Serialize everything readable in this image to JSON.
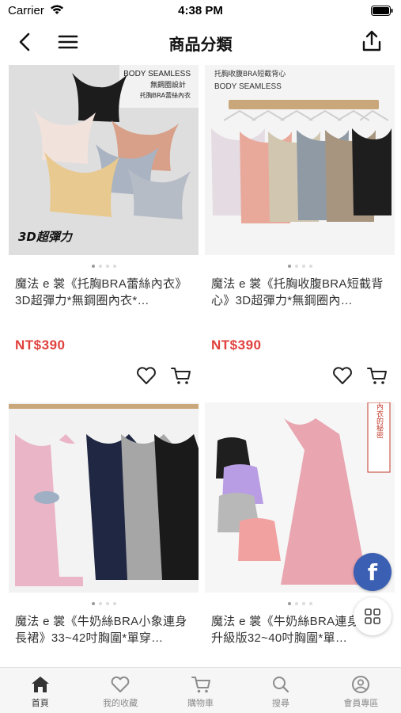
{
  "status_bar": {
    "carrier": "Carrier",
    "time": "4:38 PM"
  },
  "nav": {
    "title": "商品分類"
  },
  "products": [
    {
      "title": "魔法 e 裳《托胸BRA蕾絲內衣》3D超彈力*無鋼圈內衣*…",
      "price": "NT$390",
      "image_text": [
        "BODY SEAMLESS",
        "無鋼圈設計",
        "托胸BRA蕾絲內衣",
        "3D超彈力"
      ],
      "colors": [
        "#1c1c1c",
        "#f2e2dc",
        "#d8a089",
        "#a9b3c2",
        "#e8c98f"
      ]
    },
    {
      "title": "魔法 e 裳《托胸收腹BRA短截背心》3D超彈力*無鋼圈內…",
      "price": "NT$390",
      "image_text": [
        "托胸收腹BRA短截背心",
        "BODY SEAMLESS"
      ],
      "colors": [
        "#e5dbe2",
        "#e8a99b",
        "#d1c6b0",
        "#8f9aa5",
        "#a79580",
        "#1e1e1e"
      ]
    },
    {
      "title": "魔法 e 裳《牛奶絲BRA小象連身長裙》33~42吋胸圍*單穿…",
      "price": "",
      "image_text": [],
      "colors": [
        "#eab5c6",
        "#f3f3f3",
        "#1f2742",
        "#a6a6a6",
        "#1a1a1a"
      ]
    },
    {
      "title": "魔法 e 裳《牛奶絲BRA連身長裙》升級版32~40吋胸圍*單…",
      "price": "",
      "image_text": [
        "免穿內衣的秘密"
      ],
      "colors": [
        "#e9a5b0",
        "#1f1f1f",
        "#b89de4",
        "#b8b8b8",
        "#f2a1a1"
      ]
    }
  ],
  "floating": {
    "facebook_letter": "f"
  },
  "tabs": [
    {
      "label": "首頁",
      "icon": "home-icon",
      "active": true
    },
    {
      "label": "我的收藏",
      "icon": "heart-icon",
      "active": false
    },
    {
      "label": "購物車",
      "icon": "cart-icon",
      "active": false
    },
    {
      "label": "搜尋",
      "icon": "search-icon",
      "active": false
    },
    {
      "label": "會員專區",
      "icon": "user-icon",
      "active": false
    }
  ],
  "accent_colors": {
    "price": "#e0403c",
    "facebook": "#3b5fb3"
  }
}
